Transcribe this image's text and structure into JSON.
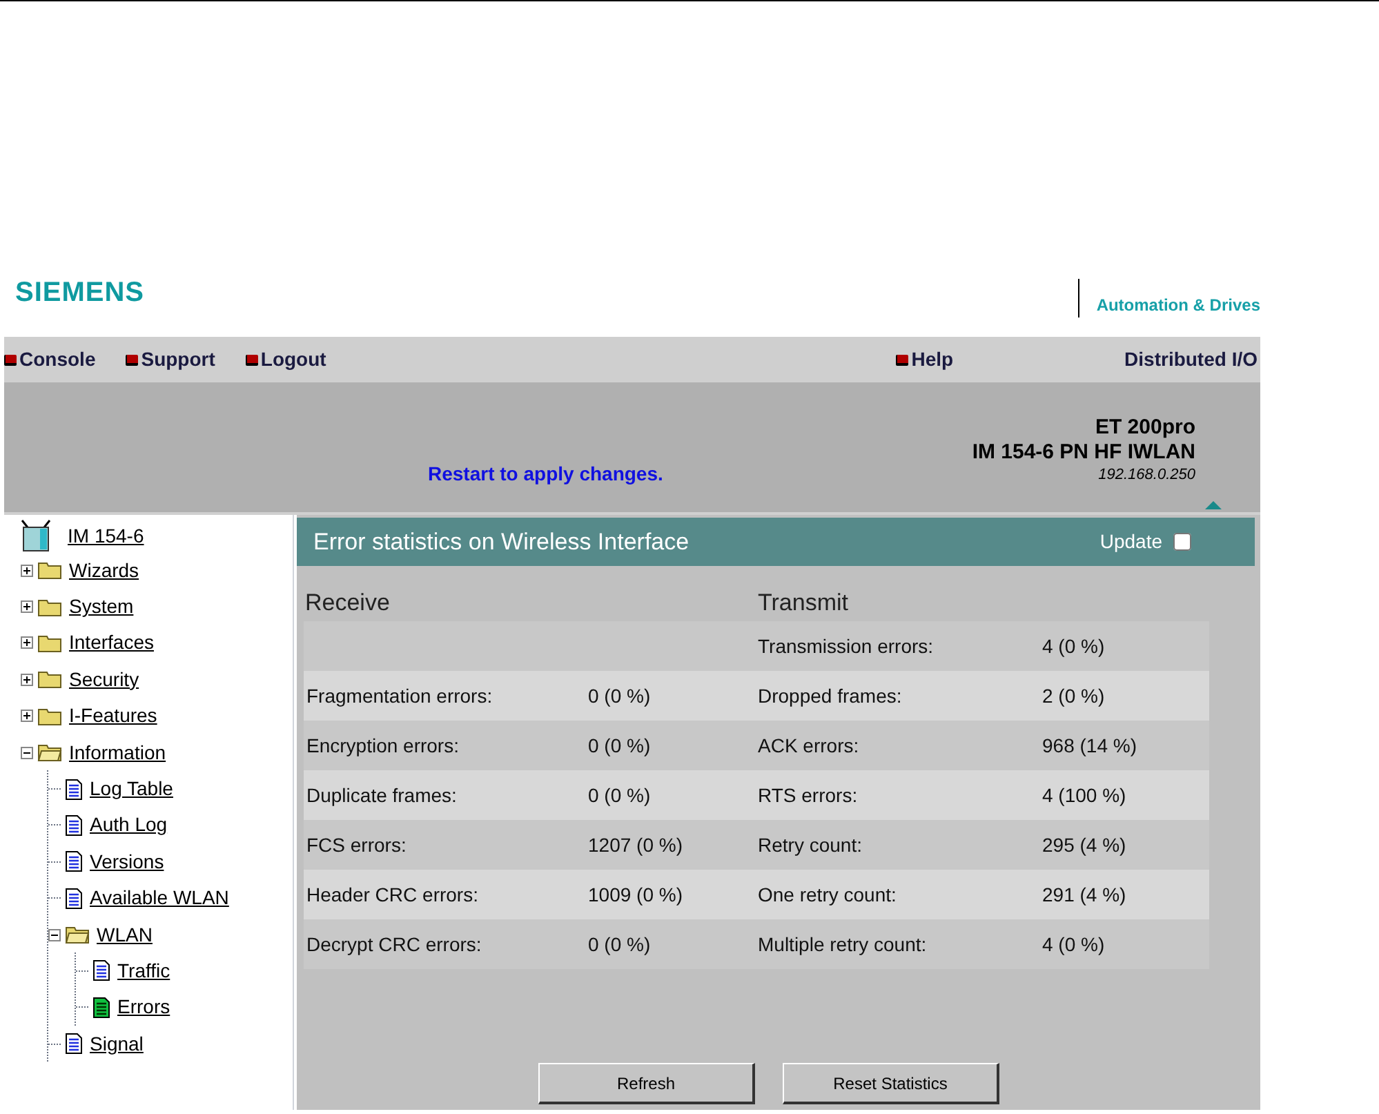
{
  "header": {
    "logo": "SIEMENS",
    "division": "Automation & Drives"
  },
  "nav": {
    "left": [
      {
        "label": "Console"
      },
      {
        "label": "Support"
      },
      {
        "label": "Logout"
      }
    ],
    "help": {
      "label": "Help"
    },
    "right_label": "Distributed I/O"
  },
  "banner": {
    "message": "Restart to apply changes.",
    "product": "ET 200pro",
    "model": "IM 154-6 PN HF IWLAN",
    "ip": "192.168.0.250"
  },
  "tree": {
    "root": {
      "label": "IM 154-6"
    },
    "items": [
      {
        "label": "Wizards",
        "kind": "folder",
        "expanded": false
      },
      {
        "label": "System",
        "kind": "folder",
        "expanded": false
      },
      {
        "label": "Interfaces",
        "kind": "folder",
        "expanded": false
      },
      {
        "label": "Security",
        "kind": "folder",
        "expanded": false
      },
      {
        "label": "I-Features",
        "kind": "folder",
        "expanded": false
      },
      {
        "label": "Information",
        "kind": "folder",
        "expanded": true,
        "children": [
          {
            "label": "Log Table",
            "kind": "page",
            "selected": false
          },
          {
            "label": "Auth Log",
            "kind": "page",
            "selected": false
          },
          {
            "label": "Versions",
            "kind": "page",
            "selected": false
          },
          {
            "label": "Available WLAN",
            "kind": "page",
            "selected": false
          },
          {
            "label": "WLAN",
            "kind": "folder",
            "expanded": true,
            "children": [
              {
                "label": "Traffic",
                "kind": "page",
                "selected": false
              },
              {
                "label": "Errors",
                "kind": "page",
                "selected": true
              }
            ]
          },
          {
            "label": "Signal",
            "kind": "page",
            "selected": false
          }
        ]
      }
    ]
  },
  "panel": {
    "title": "Error statistics on Wireless Interface",
    "update": {
      "label": "Update",
      "checked": false
    },
    "receive_heading": "Receive",
    "transmit_heading": "Transmit",
    "rows": [
      {
        "receive_label": null,
        "receive_value": null,
        "transmit_label": "Transmission errors:",
        "transmit_value": "4 (0 %)"
      },
      {
        "receive_label": "Fragmentation errors:",
        "receive_value": "0 (0 %)",
        "transmit_label": "Dropped frames:",
        "transmit_value": "2 (0 %)"
      },
      {
        "receive_label": "Encryption errors:",
        "receive_value": "0 (0 %)",
        "transmit_label": "ACK errors:",
        "transmit_value": "968 (14 %)"
      },
      {
        "receive_label": "Duplicate frames:",
        "receive_value": "0 (0 %)",
        "transmit_label": "RTS errors:",
        "transmit_value": "4 (100 %)"
      },
      {
        "receive_label": "FCS errors:",
        "receive_value": "1207 (0 %)",
        "transmit_label": "Retry count:",
        "transmit_value": "295 (4 %)"
      },
      {
        "receive_label": "Header CRC errors:",
        "receive_value": "1009 (0 %)",
        "transmit_label": "One retry count:",
        "transmit_value": "291 (4 %)"
      },
      {
        "receive_label": "Decrypt CRC errors:",
        "receive_value": "0 (0 %)",
        "transmit_label": "Multiple retry count:",
        "transmit_value": "4 (0 %)"
      }
    ],
    "buttons": [
      {
        "label": "Refresh"
      },
      {
        "label": "Reset Statistics"
      }
    ]
  }
}
